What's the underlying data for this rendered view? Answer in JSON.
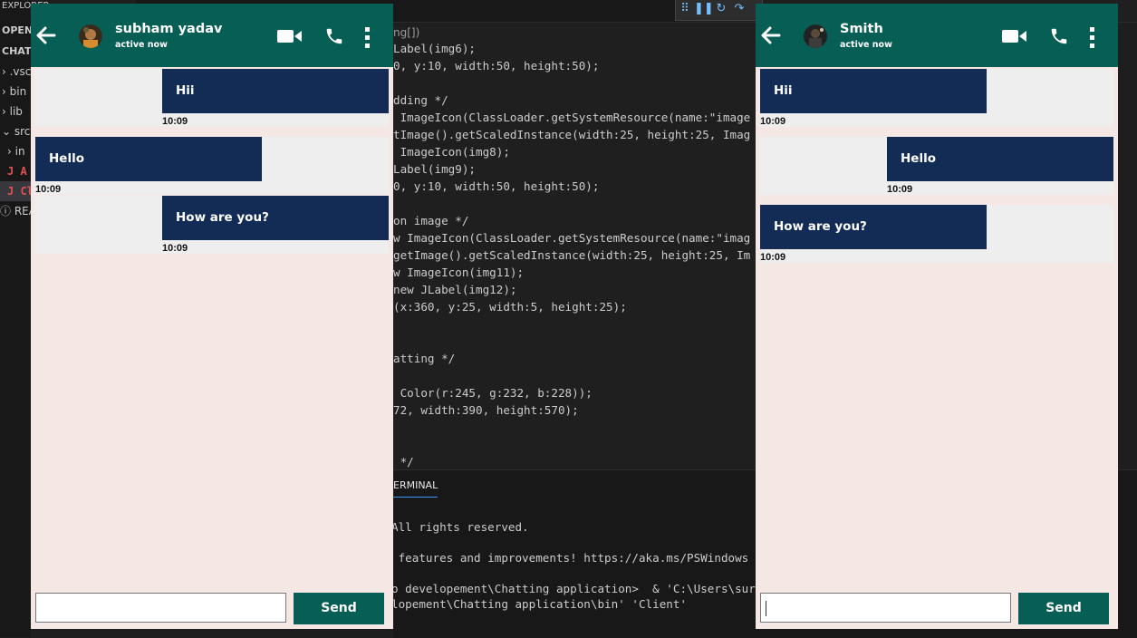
{
  "ide": {
    "sidebar_rows": [
      "EXPLORER",
      "OPEN",
      "CHATT",
      "› .vsc",
      "› bin",
      "› lib",
      "⌄ src",
      "› in",
      "J A",
      "J Cl",
      "ⓘ REA"
    ],
    "breadcrumb": "ng[])",
    "code_lines": [
      "Label(img6);",
      "0, y:10, width:50, height:50);",
      "",
      "dding */",
      " ImageIcon(ClassLoader.getSystemResource(name:\"image",
      "tImage().getScaledInstance(width:25, height:25, Imag",
      " ImageIcon(img8);",
      "Label(img9);",
      "0, y:10, width:50, height:50);",
      "",
      "on image */",
      "w ImageIcon(ClassLoader.getSystemResource(name:\"imag",
      "getImage().getScaledInstance(width:25, height:25, Im",
      "w ImageIcon(img11);",
      "new JLabel(img12);",
      "(x:360, y:25, width:5, height:25);",
      "",
      "",
      "atting */",
      "",
      " Color(r:245, g:232, b:228));",
      "72, width:390, height:570);",
      "",
      "",
      " */"
    ],
    "terminal_tab": "ERMINAL",
    "terminal_lines": [
      "All rights reserved.",
      "",
      " features and improvements! https://aka.ms/PSWindows",
      "",
      "o developement\\Chatting application>  & 'C:\\Users\\suraj\\Ap",
      "lopement\\Chatting application\\bin' 'Client'"
    ]
  },
  "left_chat": {
    "contact_name": "subham yadav",
    "status": "active now",
    "messages": [
      {
        "text": "Hii",
        "time": "10:09",
        "side": "right"
      },
      {
        "text": "Hello",
        "time": "10:09",
        "side": "left"
      },
      {
        "text": "How are you?",
        "time": "10:09",
        "side": "right"
      }
    ],
    "input_value": "",
    "send_label": "Send"
  },
  "right_chat": {
    "contact_name": "Smith",
    "status": "active now",
    "messages": [
      {
        "text": "Hii",
        "time": "10:09",
        "side": "left"
      },
      {
        "text": "Hello",
        "time": "10:09",
        "side": "right"
      },
      {
        "text": "How are you?",
        "time": "10:09",
        "side": "left"
      }
    ],
    "input_value": "",
    "send_label": "Send"
  },
  "colors": {
    "header": "#075e54",
    "bubble": "#122c56",
    "chat_background": "#f5e8e4",
    "row_background": "#eeeeee"
  },
  "icons": [
    "back-arrow-icon",
    "video-call-icon",
    "phone-icon",
    "more-vertical-icon"
  ]
}
